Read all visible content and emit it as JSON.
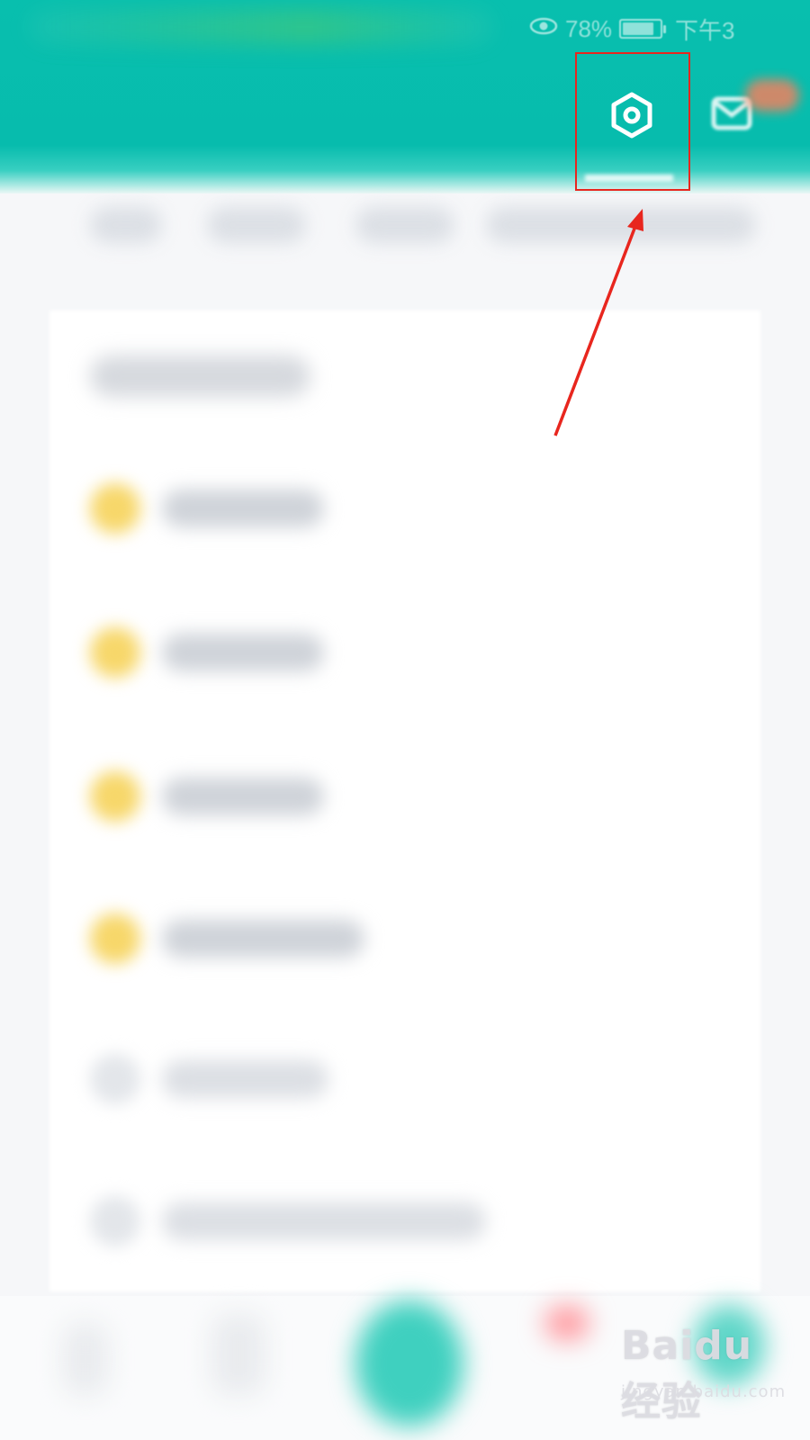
{
  "status_bar": {
    "battery_percent": "78%",
    "time": "下午3"
  },
  "header": {
    "settings_icon": "hexagon-settings-icon",
    "mail_icon": "mail-icon"
  },
  "annotation": {
    "highlight_color": "#e8261e",
    "target": "settings-button"
  },
  "watermark": {
    "line1": "Baidu 经验",
    "line2": "jingyan.baidu.com"
  },
  "colors": {
    "header_teal": "#07bcad",
    "row_icon_yellow": "#f7d76a",
    "annotation_red": "#e8261e"
  }
}
